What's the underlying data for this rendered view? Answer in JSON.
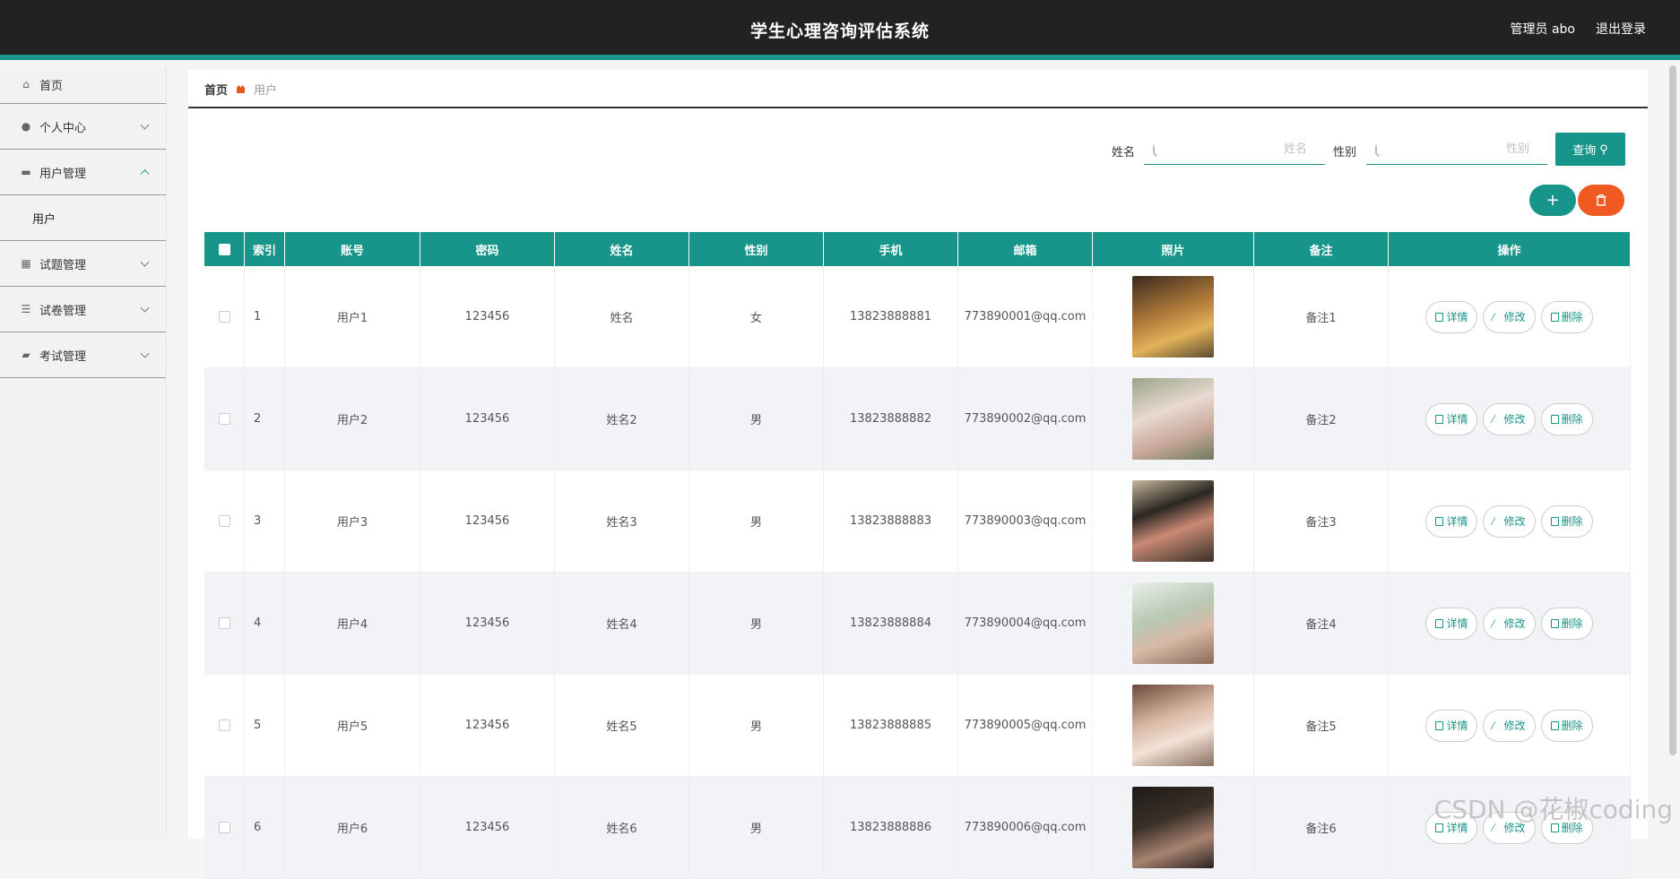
{
  "header": {
    "title": "学生心理咨询评估系统",
    "admin": "管理员 abo",
    "logout": "退出登录"
  },
  "sidebar": {
    "items": [
      {
        "label": "首页",
        "icon": "home-icon"
      },
      {
        "label": "个人中心",
        "icon": "user-icon"
      },
      {
        "label": "用户管理",
        "icon": "briefcase-icon",
        "expanded": true,
        "children": [
          "用户"
        ]
      },
      {
        "label": "试题管理",
        "icon": "grid-icon"
      },
      {
        "label": "试卷管理",
        "icon": "list-icon"
      },
      {
        "label": "考试管理",
        "icon": "ticket-icon"
      }
    ]
  },
  "breadcrumb": {
    "home": "首页",
    "current": "用户"
  },
  "search": {
    "name_label": "姓名",
    "name_placeholder": "姓名",
    "sex_label": "性别",
    "sex_placeholder": "性别",
    "query_button": "查询"
  },
  "table": {
    "columns": [
      "索引",
      "账号",
      "密码",
      "姓名",
      "性别",
      "手机",
      "邮箱",
      "照片",
      "备注",
      "操作"
    ],
    "rows": [
      {
        "index": "1",
        "account": "用户1",
        "password": "123456",
        "name": "姓名",
        "sex": "女",
        "phone": "13823888881",
        "email": "773890001@qq.com",
        "note": "备注1"
      },
      {
        "index": "2",
        "account": "用户2",
        "password": "123456",
        "name": "姓名2",
        "sex": "男",
        "phone": "13823888882",
        "email": "773890002@qq.com",
        "note": "备注2"
      },
      {
        "index": "3",
        "account": "用户3",
        "password": "123456",
        "name": "姓名3",
        "sex": "男",
        "phone": "13823888883",
        "email": "773890003@qq.com",
        "note": "备注3"
      },
      {
        "index": "4",
        "account": "用户4",
        "password": "123456",
        "name": "姓名4",
        "sex": "男",
        "phone": "13823888884",
        "email": "773890004@qq.com",
        "note": "备注4"
      },
      {
        "index": "5",
        "account": "用户5",
        "password": "123456",
        "name": "姓名5",
        "sex": "男",
        "phone": "13823888885",
        "email": "773890005@qq.com",
        "note": "备注5"
      },
      {
        "index": "6",
        "account": "用户6",
        "password": "123456",
        "name": "姓名6",
        "sex": "男",
        "phone": "13823888886",
        "email": "773890006@qq.com",
        "note": "备注6"
      }
    ],
    "actions": {
      "detail": "详情",
      "edit": "修改",
      "delete": "删除"
    }
  },
  "watermark": "CSDN @花椒coding",
  "colors": {
    "accent": "#18958a",
    "danger": "#f05a22",
    "topbar": "#222222"
  }
}
